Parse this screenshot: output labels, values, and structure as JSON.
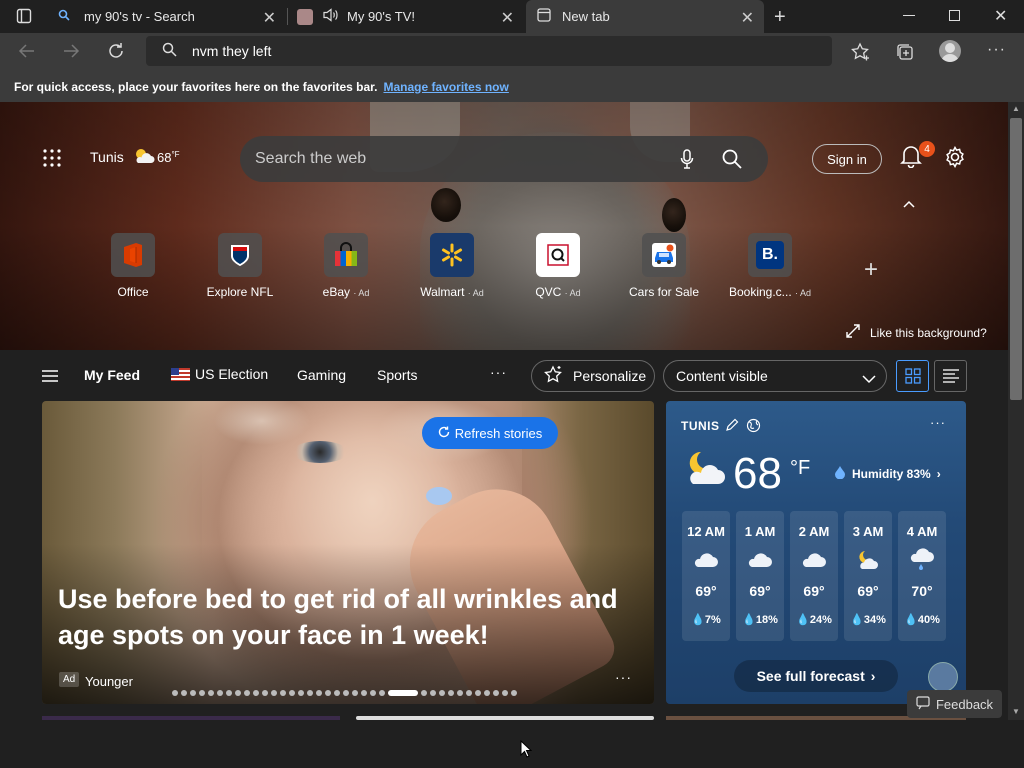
{
  "tabs": [
    {
      "title": "my 90's tv - Search",
      "icon": "search-icon"
    },
    {
      "title": "My 90's TV!",
      "icon": "speaker-icon"
    },
    {
      "title": "New tab",
      "icon": "new-tab-icon"
    }
  ],
  "address": {
    "value": "nvm they left"
  },
  "favorites_bar": {
    "message": "For quick access, place your favorites here on the favorites bar.",
    "link": "Manage favorites now"
  },
  "hero": {
    "location": "Tunis",
    "temp": "68",
    "unit": "°F",
    "search_placeholder": "Search the web",
    "sign_in": "Sign in",
    "notification_count": "4",
    "like_background": "Like this background?"
  },
  "quick_links": [
    {
      "label": "Office",
      "ad": ""
    },
    {
      "label": "Explore NFL",
      "ad": ""
    },
    {
      "label": "eBay",
      "ad": "· Ad"
    },
    {
      "label": "Walmart",
      "ad": "· Ad"
    },
    {
      "label": "QVC",
      "ad": "· Ad"
    },
    {
      "label": "Cars for Sale",
      "ad": ""
    },
    {
      "label": "Booking.c...",
      "ad": "· Ad"
    }
  ],
  "feed_nav": {
    "items": [
      "My Feed",
      "US Election",
      "Gaming",
      "Sports"
    ],
    "personalize": "Personalize",
    "content_visible": "Content visible"
  },
  "main_story": {
    "refresh": "Refresh stories",
    "headline": "Use before bed to get rid of all wrinkles and age spots on your face in 1 week!",
    "ad_badge": "Ad",
    "source": "Younger"
  },
  "weather": {
    "city": "TUNIS",
    "temp": "68",
    "unit": "°F",
    "humidity": "Humidity 83%",
    "hours": [
      {
        "time": "12 AM",
        "temp": "69°",
        "precip": "7%",
        "icon": "cloud"
      },
      {
        "time": "1 AM",
        "temp": "69°",
        "precip": "18%",
        "icon": "cloud"
      },
      {
        "time": "2 AM",
        "temp": "69°",
        "precip": "24%",
        "icon": "cloud"
      },
      {
        "time": "3 AM",
        "temp": "69°",
        "precip": "34%",
        "icon": "partly-cloudy"
      },
      {
        "time": "4 AM",
        "temp": "70°",
        "precip": "40%",
        "icon": "rain"
      }
    ],
    "full_forecast": "See full forecast"
  },
  "feedback": "Feedback",
  "colors": {
    "accent": "#1a73e8",
    "weather_bg": "#234a77",
    "badge": "#e8511a"
  }
}
